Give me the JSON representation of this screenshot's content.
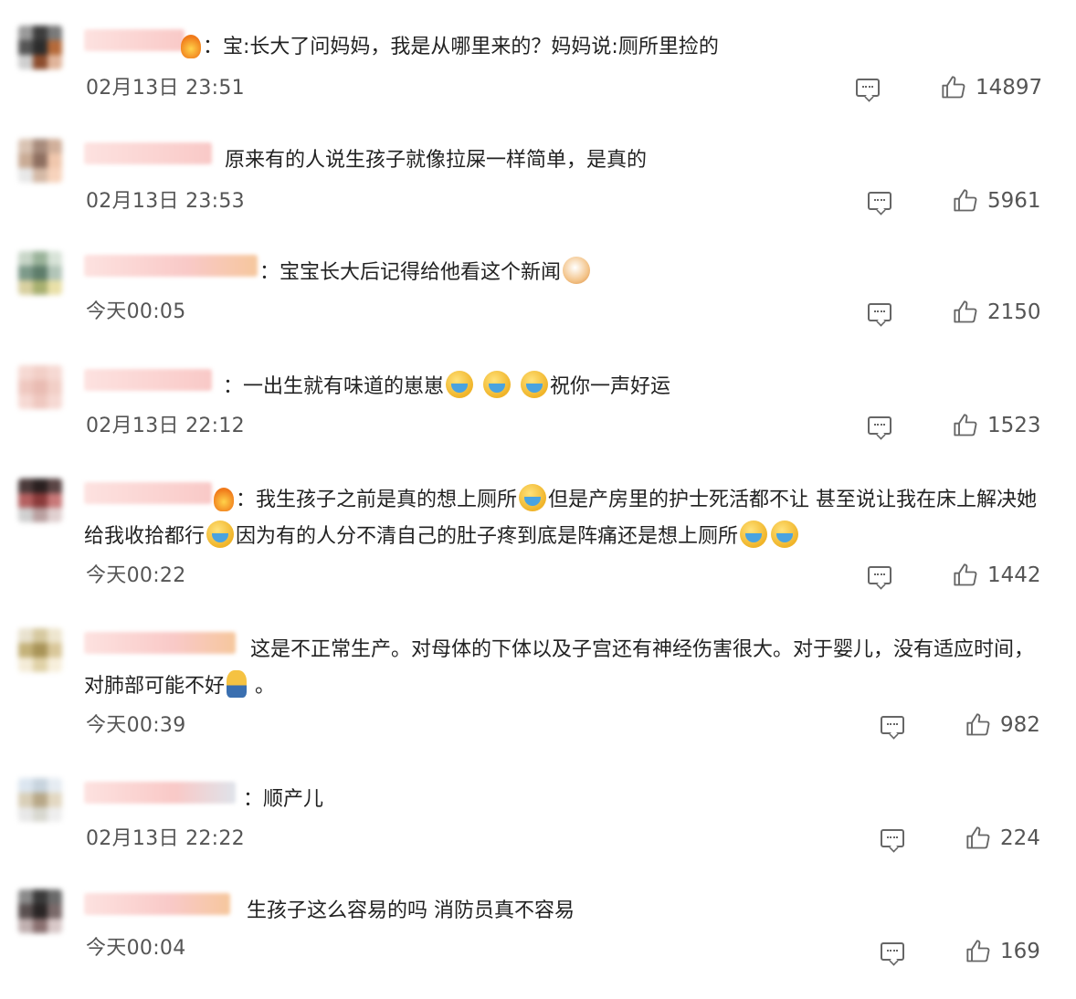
{
  "comments": [
    {
      "text_lead": "：宝:长大了问妈妈，我是从哪里来的？妈妈说:厕所里捡的",
      "time": "02月13日 23:51",
      "likes": "14897"
    },
    {
      "text_lead": "原来有的人说生孩子就像拉屎一样简单，是真的",
      "time": "02月13日 23:53",
      "likes": "5961"
    },
    {
      "text_lead": "：宝宝长大后记得给他看这个新闻",
      "time": "今天00:05",
      "likes": "2150"
    },
    {
      "text_lead": "：一出生就有味道的崽崽",
      "text_tail": "祝你一声好运",
      "time": "02月13日 22:12",
      "likes": "1523"
    },
    {
      "text_lead": "：我生孩子之前是真的想上厕所",
      "text_mid": "但是产房里的护士死活都不让 甚至说让我在床上解决她给我收拾都行",
      "text_tail": "因为有的人分不清自己的肚子疼到底是阵痛还是想上厕所",
      "time": "今天00:22",
      "likes": "1442"
    },
    {
      "text_lead": "这是不正常生产。对母体的下体以及子宫还有神经伤害很大。对于婴儿，没有适应时间，对肺部可能不好",
      "text_tail": "。",
      "time": "今天00:39",
      "likes": "982"
    },
    {
      "text_lead": "：顺产儿",
      "time": "02月13日 22:22",
      "likes": "224"
    },
    {
      "text_lead": "生孩子这么容易的吗 消防员真不容易",
      "time": "今天00:04",
      "likes": "169"
    }
  ],
  "icons": {
    "reply": "comment-icon",
    "like": "thumbs-up-icon"
  },
  "colors": {
    "text": "#222222",
    "meta": "#555555",
    "icon": "#666666"
  }
}
